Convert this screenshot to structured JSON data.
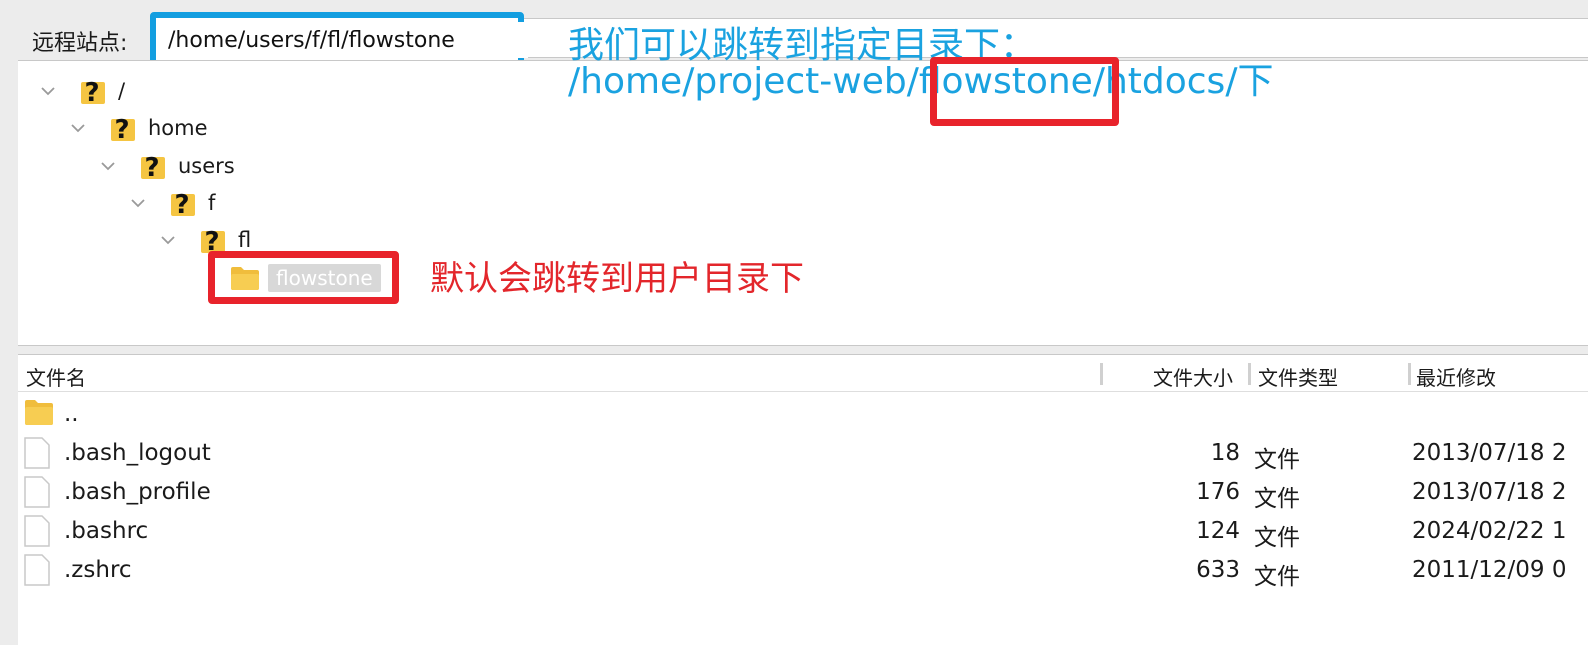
{
  "toolbar": {
    "remote_site_label": "远程站点:",
    "remote_path_value": "/home/users/f/fl/flowstone"
  },
  "tree": [
    {
      "label": "/",
      "icon": "unknown-folder-icon"
    },
    {
      "label": "home",
      "icon": "unknown-folder-icon"
    },
    {
      "label": "users",
      "icon": "unknown-folder-icon"
    },
    {
      "label": "f",
      "icon": "unknown-folder-icon"
    },
    {
      "label": "fl",
      "icon": "unknown-folder-icon"
    },
    {
      "label": "flowstone",
      "icon": "folder-icon",
      "selected": true
    }
  ],
  "annotations": {
    "blue_line1": "我们可以跳转到指定目录下：",
    "blue_line2": "/home/project-web/flowstone/htdocs/下",
    "red_note": "默认会跳转到用户目录下",
    "colors": {
      "blue": "#1aa2e0",
      "red": "#e8232b"
    }
  },
  "file_list": {
    "columns": [
      "文件名",
      "文件大小",
      "文件类型",
      "最近修改"
    ],
    "rows": [
      {
        "name": "..",
        "size": "",
        "type": "",
        "modified": "",
        "icon": "folder-icon"
      },
      {
        "name": ".bash_logout",
        "size": "18",
        "type": "文件",
        "modified": "2013/07/18 2",
        "icon": "file-icon"
      },
      {
        "name": ".bash_profile",
        "size": "176",
        "type": "文件",
        "modified": "2013/07/18 2",
        "icon": "file-icon"
      },
      {
        "name": ".bashrc",
        "size": "124",
        "type": "文件",
        "modified": "2024/02/22 1",
        "icon": "file-icon"
      },
      {
        "name": ".zshrc",
        "size": "633",
        "type": "文件",
        "modified": "2011/12/09 0",
        "icon": "file-icon"
      }
    ]
  }
}
